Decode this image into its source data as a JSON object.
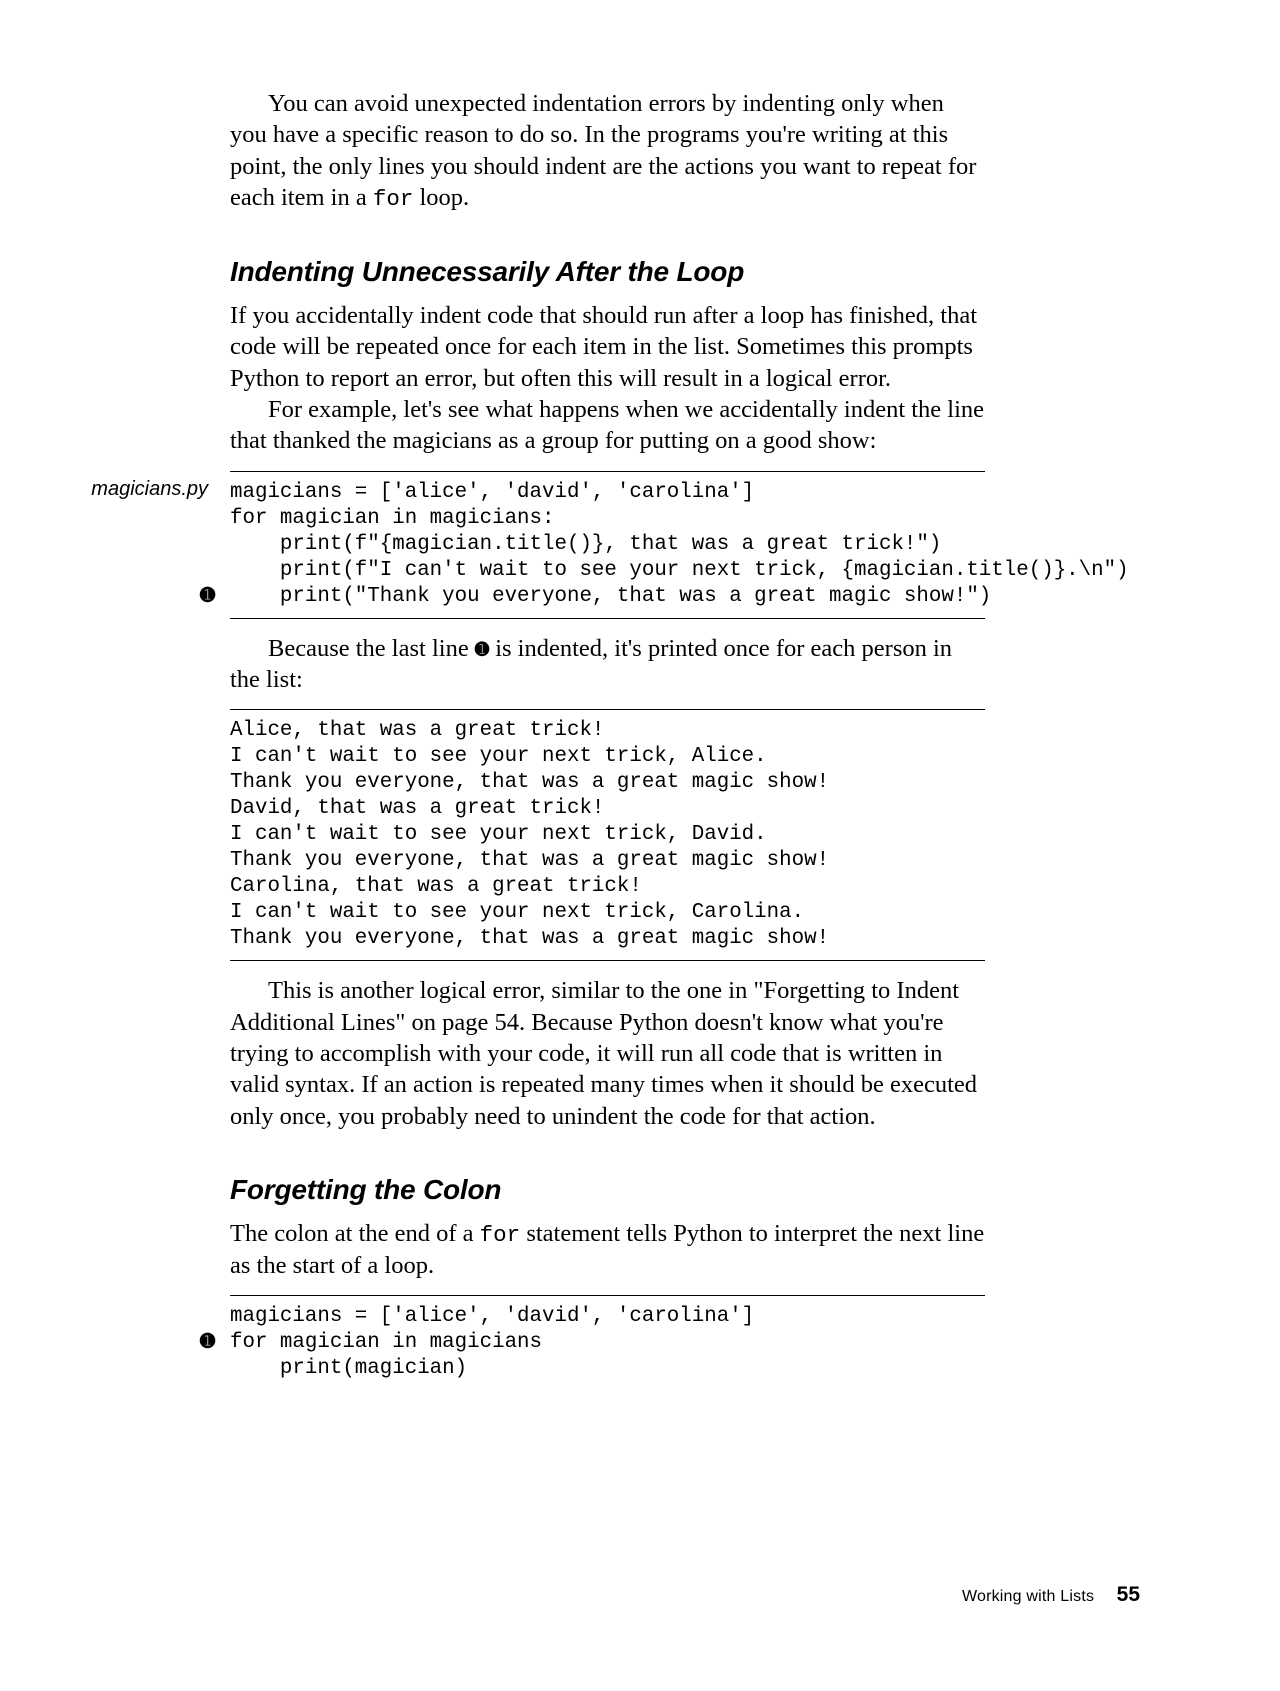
{
  "para1": "You can avoid unexpected indentation errors by indenting only when you have a specific reason to do so. In the programs you're writing at this point, the only lines you should indent are the actions you want to repeat for each item in a ",
  "para1_code": "for",
  "para1_end": " loop.",
  "heading1": "Indenting Unnecessarily After the Loop",
  "para2": "If you accidentally indent code that should run after a loop has finished, that code will be repeated once for each item in the list. Sometimes this prompts Python to report an error, but often this will result in a logical error.",
  "para3": "For example, let's see what happens when we accidentally indent the line that thanked the magicians as a group for putting on a good show:",
  "code1_label": "magicians.py",
  "code1": {
    "l1": "magicians = ['alice', 'david', 'carolina']",
    "l2": "for magician in magicians:",
    "l3": "    print(f\"{magician.title()}, that was a great trick!\")",
    "l4": "    print(f\"I can't wait to see your next trick, {magician.title()}.\\n\")",
    "l5": "",
    "l6": "    print(\"Thank you everyone, that was a great magic show!\")"
  },
  "callout1": "➊",
  "para4_pre": "Because the last line ",
  "para4_callout": "➊",
  "para4_post": " is indented, it's printed once for each person in the list:",
  "output1": {
    "l1": "Alice, that was a great trick!",
    "l2": "I can't wait to see your next trick, Alice.",
    "l3": "",
    "l4": "Thank you everyone, that was a great magic show!",
    "l5": "David, that was a great trick!",
    "l6": "I can't wait to see your next trick, David.",
    "l7": "",
    "l8": "Thank you everyone, that was a great magic show!",
    "l9": "Carolina, that was a great trick!",
    "l10": "I can't wait to see your next trick, Carolina.",
    "l11": "",
    "l12": "Thank you everyone, that was a great magic show!"
  },
  "para5": "This is another logical error, similar to the one in \"Forgetting to Indent Additional Lines\" on page 54. Because Python doesn't know what you're trying to accomplish with your code, it will run all code that is written in valid syntax. If an action is repeated many times when it should be executed only once, you probably need to unindent the code for that action.",
  "heading2": "Forgetting the Colon",
  "para6_pre": "The colon at the end of a ",
  "para6_code": "for",
  "para6_post": " statement tells Python to interpret the next line as the start of a loop.",
  "code2": {
    "l1": "magicians = ['alice', 'david', 'carolina']",
    "l2": "for magician in magicians",
    "l3": "    print(magician)"
  },
  "callout2": "➊",
  "footer_chapter": "Working with Lists",
  "footer_page": "55"
}
